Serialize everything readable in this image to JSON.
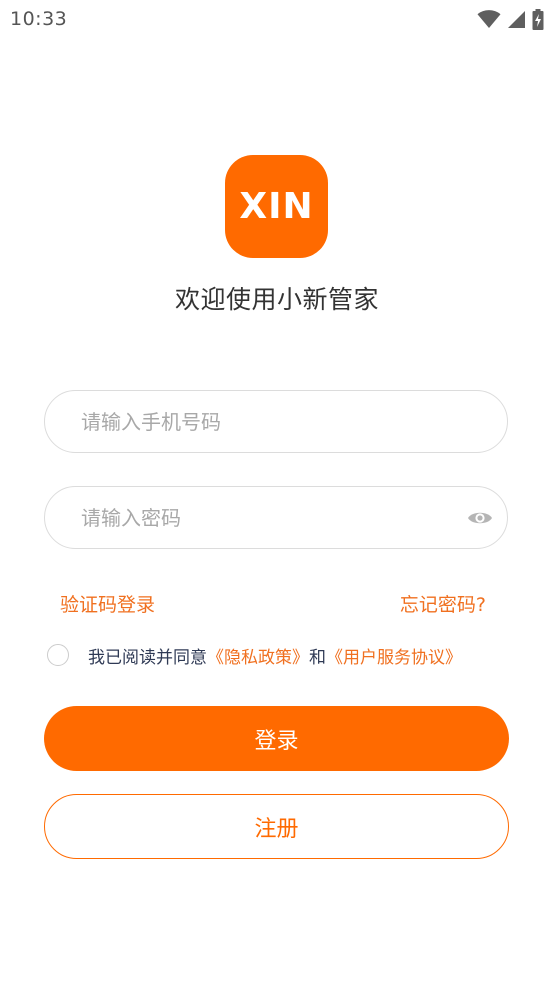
{
  "status_bar": {
    "time": "10:33",
    "icons": [
      "wifi-icon",
      "cellular-signal-icon",
      "battery-charging-icon"
    ]
  },
  "logo": {
    "text": "XIN",
    "color": "#FF6A00"
  },
  "title": "欢迎使用小新管家",
  "phone_input": {
    "placeholder": "请输入手机号码",
    "value": ""
  },
  "password_input": {
    "placeholder": "请输入密码",
    "value": "",
    "toggle_icon": "eye-icon"
  },
  "links": {
    "sms_login": "验证码登录",
    "forgot_password": "忘记密码?"
  },
  "agreement": {
    "checked": false,
    "prefix": "我已阅读并同意",
    "privacy_policy": "《隐私政策》",
    "conjunction": "和",
    "user_agreement": "《用户服务协议》"
  },
  "buttons": {
    "login": "登录",
    "register": "注册"
  },
  "colors": {
    "accent": "#FF6A00",
    "link": "#F07020",
    "text_dark": "#333333",
    "placeholder": "#A8A8A8",
    "border": "#DCDCDC"
  }
}
